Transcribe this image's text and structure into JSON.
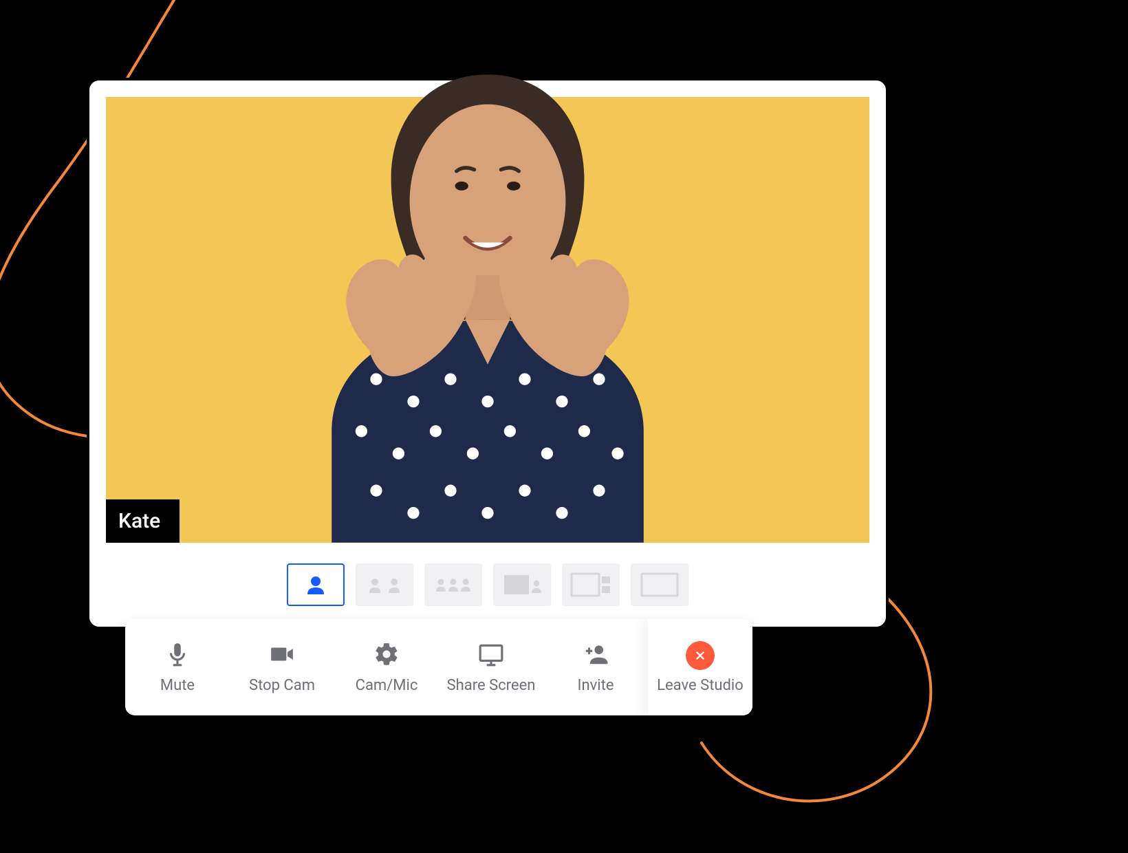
{
  "participant": {
    "name": "Kate"
  },
  "layouts": [
    {
      "id": "single",
      "active": true
    },
    {
      "id": "two-up",
      "active": false
    },
    {
      "id": "three-up",
      "active": false
    },
    {
      "id": "screen-small",
      "active": false
    },
    {
      "id": "screen-side",
      "active": false
    },
    {
      "id": "screen-full",
      "active": false
    }
  ],
  "toolbar": {
    "mute_label": "Mute",
    "stop_cam_label": "Stop Cam",
    "cam_mic_label": "Cam/Mic",
    "share_screen_label": "Share Screen",
    "invite_label": "Invite",
    "leave_label": "Leave Studio"
  },
  "colors": {
    "accent_blue": "#155cff",
    "feed_bg": "#f3c756",
    "swoosh": "#f5873c",
    "leave_red": "#ff5a3c"
  }
}
